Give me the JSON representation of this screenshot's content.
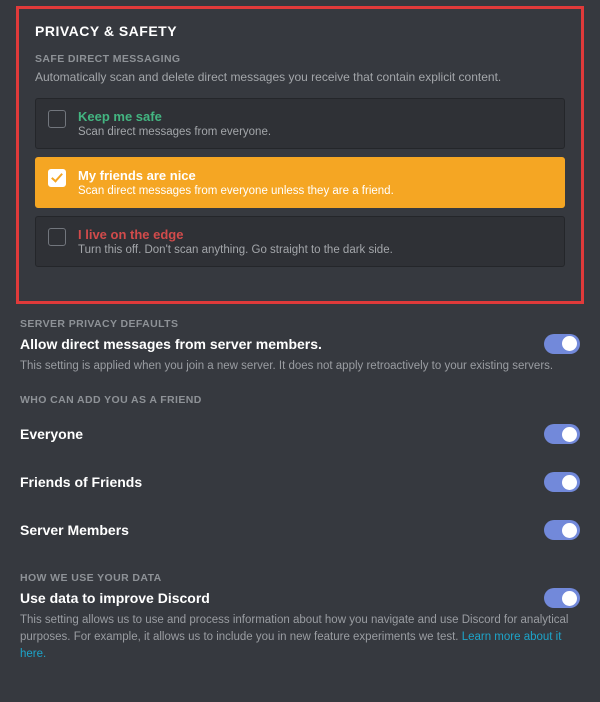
{
  "title": "PRIVACY & SAFETY",
  "safeDM": {
    "heading": "SAFE DIRECT MESSAGING",
    "desc": "Automatically scan and delete direct messages you receive that contain explicit content.",
    "options": [
      {
        "title": "Keep me safe",
        "sub": "Scan direct messages from everyone."
      },
      {
        "title": "My friends are nice",
        "sub": "Scan direct messages from everyone unless they are a friend."
      },
      {
        "title": "I live on the edge",
        "sub": "Turn this off. Don't scan anything. Go straight to the dark side."
      }
    ]
  },
  "serverPrivacy": {
    "heading": "SERVER PRIVACY DEFAULTS",
    "toggleLabel": "Allow direct messages from server members.",
    "note": "This setting is applied when you join a new server. It does not apply retroactively to your existing servers."
  },
  "friendAdd": {
    "heading": "WHO CAN ADD YOU AS A FRIEND",
    "rows": [
      "Everyone",
      "Friends of Friends",
      "Server Members"
    ]
  },
  "dataUse": {
    "heading": "HOW WE USE YOUR DATA",
    "toggleLabel": "Use data to improve Discord",
    "note": "This setting allows us to use and process information about how you navigate and use Discord for analytical purposes. For example, it allows us to include you in new feature experiments we test. ",
    "link": "Learn more about it here."
  }
}
